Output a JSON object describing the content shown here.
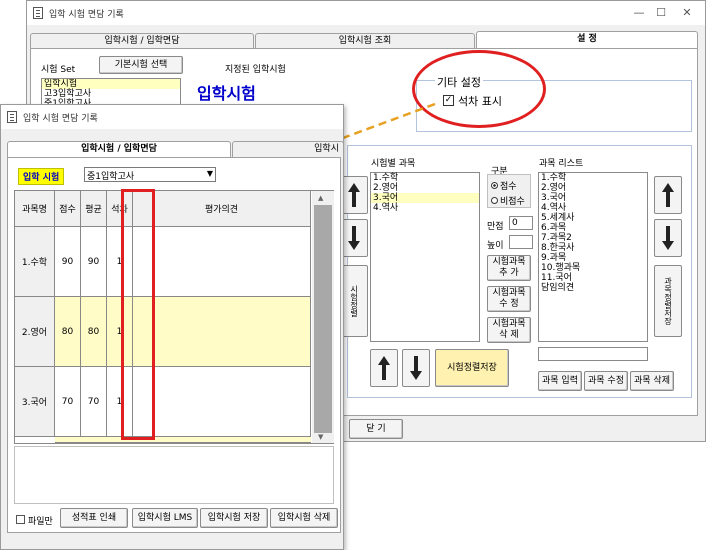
{
  "back_window": {
    "title": "입학 시험 면담 기록",
    "tabs": [
      {
        "label": "입학시험 / 입학면담"
      },
      {
        "label": "입학시험 조회"
      },
      {
        "label": "설 정"
      }
    ],
    "exam_set_label": "시험 Set",
    "basic_exam_select_button": "기본시험 선택",
    "designated_exam_label": "지정된 입학시험",
    "designated_exam_value": "입학시험",
    "exam_set_list": [
      "입학시험",
      "고3입학고사",
      "중1입학고사"
    ],
    "other_settings": {
      "legend": "기타 설정",
      "rank_display_checkbox_label": "석차 표시",
      "rank_display_checked": true
    },
    "subject_by_exam_label": "시험별 과목",
    "subject_by_exam_list": [
      "1.수학",
      "2.영어",
      "3.국어",
      "4.역사"
    ],
    "subject_by_exam_selected_index": 2,
    "division_label": "구분",
    "division_options": [
      "점수",
      "비점수"
    ],
    "division_selected": "점수",
    "full_score_label": "만점",
    "full_score_value": "0",
    "height_label": "높이",
    "add_subject_button": "시험과목 추 가",
    "edit_subject_button": "시험과목 수 정",
    "delete_subject_button": "시험과목 삭 제",
    "save_exam_order_button": "시험정렬저장",
    "left_vertical_button": "시험정렬",
    "subject_list_label": "과목 리스트",
    "subject_list": [
      "1.수학",
      "2.영어",
      "3.국어",
      "4.역사",
      "5.세계사",
      "6.과목",
      "7.과목2",
      "8.한국사",
      "9.과목",
      "10.행과목",
      "11.국어",
      "담임의견"
    ],
    "subject_order_save_button": "과목정렬저장",
    "subject_input_button": "과목 입력",
    "subject_edit_button": "과목 수정",
    "subject_delete_button": "과목 삭제",
    "close_button": "닫 기"
  },
  "front_window": {
    "title": "입학 시험 면담 기록",
    "tabs": [
      {
        "label": "입학시험 / 입학면담"
      },
      {
        "label": "입학시"
      }
    ],
    "exam_badge": "입학 시험",
    "exam_select_value": "중1입학고사",
    "grid_headers": [
      "과목명",
      "점수",
      "평균",
      "석차",
      "평가의견"
    ],
    "grid_rows": [
      {
        "subject": "1.수학",
        "score": "90",
        "avg": "90",
        "rank": "1"
      },
      {
        "subject": "2.영어",
        "score": "80",
        "avg": "80",
        "rank": "1"
      },
      {
        "subject": "3.국어",
        "score": "70",
        "avg": "70",
        "rank": "1"
      }
    ],
    "file_only_label": "파일만",
    "print_report_button": "성적표 인쇄",
    "lms_button": "입학시험 LMS",
    "save_button": "입학시험 저장",
    "delete_button": "입학시험 삭제"
  },
  "colors": {
    "highlight_red": "#e02020",
    "callout_orange": "#e8a020",
    "yellow_row": "#fffcc8",
    "save_button_yellow": "#fff1b0",
    "badge_yellow": "#ffff00",
    "title_blue": "#0000cc"
  }
}
